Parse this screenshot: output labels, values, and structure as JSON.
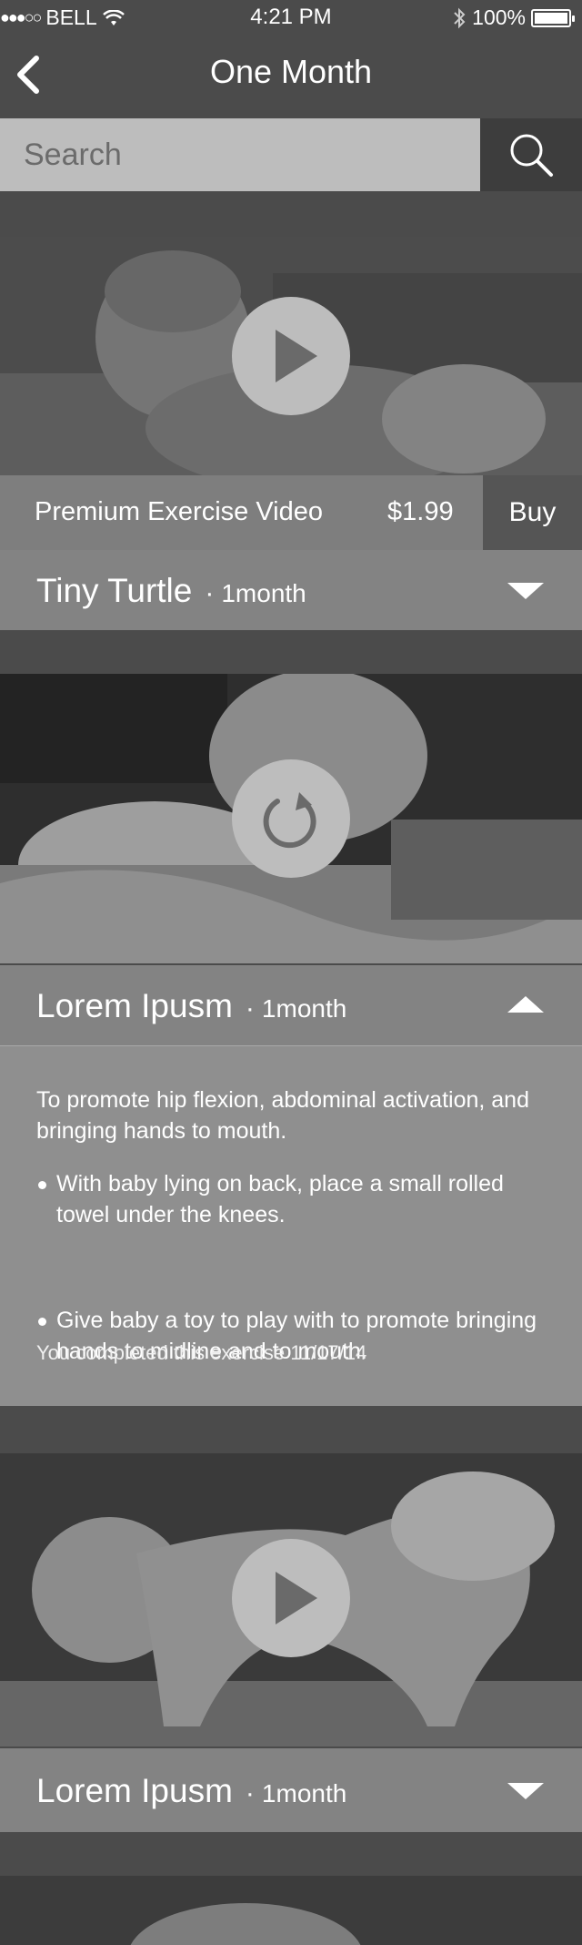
{
  "status_bar": {
    "carrier": "BELL",
    "time": "4:21 PM",
    "battery": "100%"
  },
  "nav": {
    "title": "One Month",
    "back_icon": "chevron-left-icon"
  },
  "search": {
    "placeholder": "Search",
    "value": "",
    "icon": "search-icon"
  },
  "cards": [
    {
      "action_icon": "play-icon",
      "premium": {
        "label": "Premium Exercise Video",
        "price": "$1.99",
        "buy_label": "Buy"
      },
      "title": "Tiny Turtle",
      "separator": "·",
      "duration": "1month",
      "expanded": false
    },
    {
      "action_icon": "replay-icon",
      "title": "Lorem Ipusm",
      "separator": "·",
      "duration": "1month",
      "expanded": true,
      "description": "To promote hip flexion, abdominal activation, and bringing hands to mouth.",
      "steps": [
        "With baby lying on back, place a small rolled towel under the knees.",
        "Give baby a toy to play with to promote bringing hands to midline and to mouth."
      ],
      "completed_text": "You completed this exercise 11/17/14"
    },
    {
      "action_icon": "play-icon",
      "title": "Lorem Ipusm",
      "separator": "·",
      "duration": "1month",
      "expanded": false
    }
  ],
  "colors": {
    "background": "#4b4b4b",
    "bar": "#838383",
    "detail": "#8f8f8f",
    "search_field": "#bdbdbd",
    "button_dark": "#3d3d3d"
  }
}
